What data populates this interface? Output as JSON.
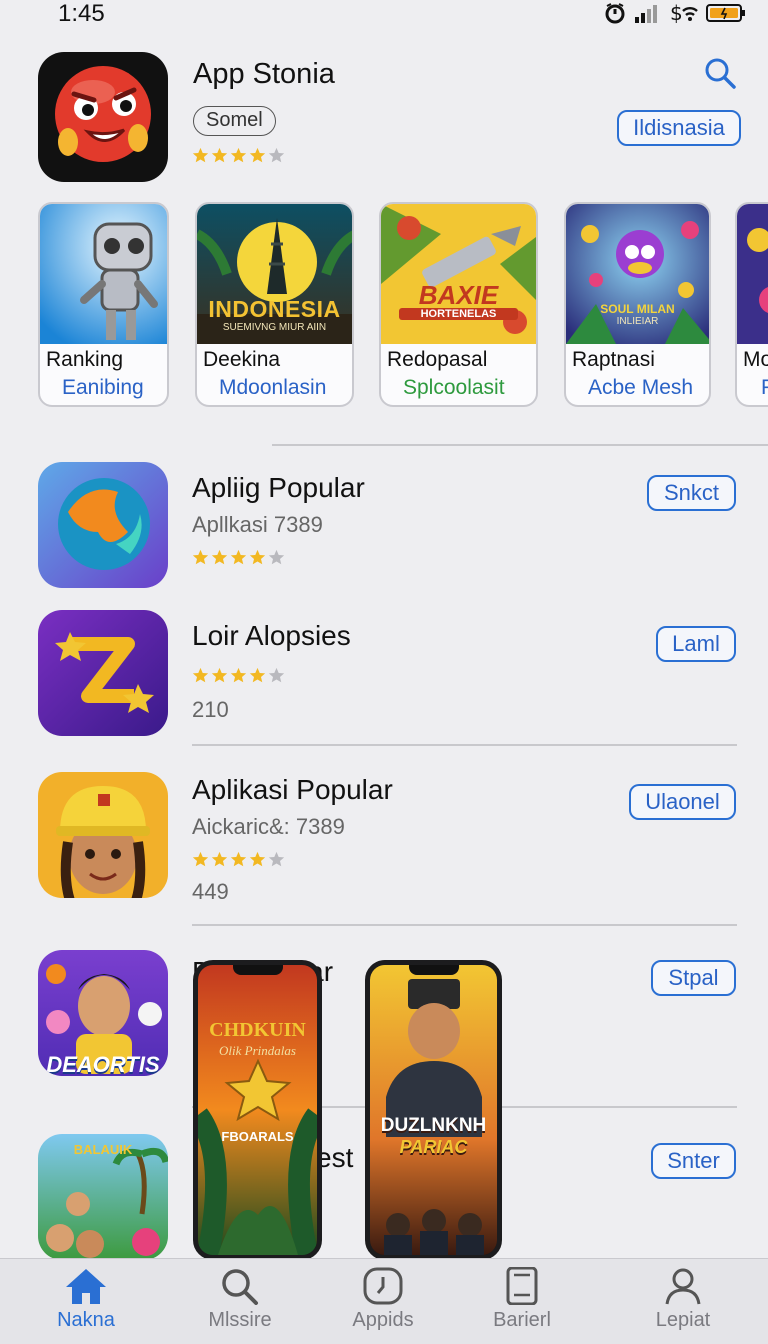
{
  "status": {
    "time": "1:45"
  },
  "hero": {
    "title": "App Stonia",
    "pill": "Somel",
    "rating": 4,
    "button": "Ildisnasia",
    "icon": "red-emoji-app-icon"
  },
  "carousel": [
    {
      "title": "Ranking",
      "subtitle": "Eanibing",
      "sub_color": "#2a62c6",
      "icon": "robot-art"
    },
    {
      "title": "Deekina",
      "subtitle": "Mdoonlasin",
      "sub_color": "#2a62c6",
      "icon": "indonesia-tower-art",
      "art_title": "INDONESIA",
      "art_sub": "SUEMIVNG MIUR AIIN"
    },
    {
      "title": "Redopasal",
      "subtitle": "Splcoolasit",
      "sub_color": "#2e9a3e",
      "icon": "baxie-game-art",
      "art_title": "BAXIE",
      "art_sub": "HORTENELAS"
    },
    {
      "title": "Raptnasi",
      "subtitle": "Acbe Mesh",
      "sub_color": "#2a62c6",
      "icon": "soul-milan-game-art",
      "art_title": "SOUL MILAN",
      "art_sub": "INLIEIAR"
    },
    {
      "title": "Mo",
      "subtitle": "P",
      "sub_color": "#2a62c6",
      "icon": "partial-game-art"
    }
  ],
  "list": [
    {
      "title": "Apliig Popular",
      "subtitle": "Apllkasi 7389",
      "rating": 4,
      "count": "",
      "button": "Snkct",
      "icon": "globe-app-icon"
    },
    {
      "title": "Loir Alopsies",
      "subtitle": "",
      "rating": 4,
      "count": "210",
      "button": "Laml",
      "icon": "stars-app-icon"
    },
    {
      "title": "Aplikasi Popular",
      "subtitle": "Aickaric&: 7389",
      "rating": 4,
      "count": "449",
      "button": "Ulaonel",
      "icon": "hardhat-girl-app-icon"
    },
    {
      "title": "Dalak Tlkar",
      "subtitle": "",
      "rating": 0,
      "count": "",
      "button": "Stpal",
      "icon": "deaortis-game-icon",
      "icon_text": "DEAORTIS"
    },
    {
      "title": "est",
      "subtitle": "",
      "rating": 0,
      "count": "",
      "button": "Snter",
      "icon": "kids-game-icon",
      "icon_text": "BALAUIK"
    }
  ],
  "phones": [
    {
      "title": "CHDKUIN",
      "subtitle": "Olik Prindalas",
      "footer": "FBOARALS",
      "icon": "phone-screen-jungle"
    },
    {
      "title": "DUZLNKNH",
      "subtitle": "PARIAC",
      "icon": "phone-screen-officer"
    }
  ],
  "tabs": [
    {
      "label": "Nakna",
      "icon": "home-icon",
      "active": true
    },
    {
      "label": "Mlssire",
      "icon": "search-icon",
      "active": false
    },
    {
      "label": "Appids",
      "icon": "clock-icon",
      "active": false
    },
    {
      "label": "Barierl",
      "icon": "tablet-icon",
      "active": false
    },
    {
      "label": "Lepiat",
      "icon": "person-icon",
      "active": false
    }
  ],
  "colors": {
    "accent": "#2a6fd3",
    "star": "#f2b822",
    "star_empty": "#b9b9be"
  }
}
